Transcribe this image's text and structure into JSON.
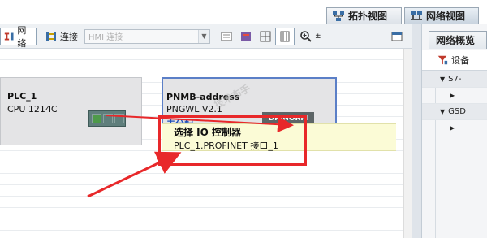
{
  "view_tabs": {
    "topology": "拓扑视图",
    "network": "网络视图"
  },
  "toolbar": {
    "network": "网络",
    "connections": "连接",
    "connection_type_placeholder": "HMI 连接"
  },
  "right_panel": {
    "tab": "网络概览",
    "column_device": "设备",
    "rows": [
      "S7-",
      "",
      "GSD",
      ""
    ]
  },
  "devices": [
    {
      "name": "PLC_1",
      "type": "CPU 1214C"
    },
    {
      "name": "PNMB-address",
      "type": "PNGWL V2.1",
      "assign_link": "未分配",
      "port_tag": "DP-NORM"
    }
  ],
  "tooltip": {
    "title": "选择 IO 控制器",
    "option": "PLC_1.PROFINET 接口_1"
  },
  "watermark": "技术布手",
  "colors": {
    "highlight_red": "#e8282a",
    "tooltip_bg": "#fbfbd6",
    "selected_border": "#5b7fc7",
    "port_green": "#5f7e7c"
  }
}
